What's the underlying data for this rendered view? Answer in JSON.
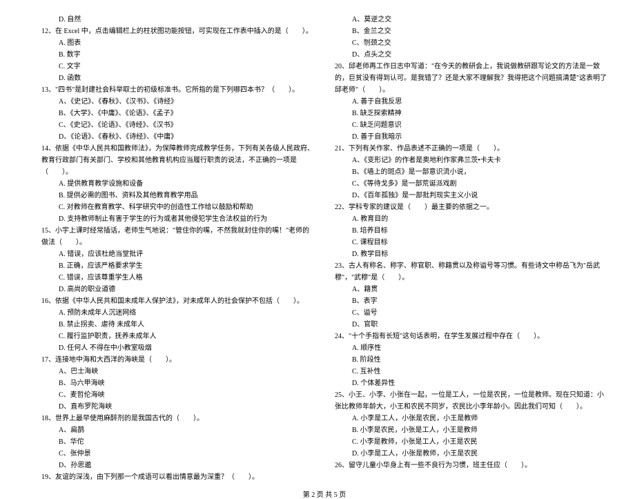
{
  "left": {
    "q11_d": "D. 自然",
    "q12": "12、在 Excel 中，点击编辑栏上的柱状图功能按钮，可实现在工作表中插入的是（　　）。",
    "q12_a": "A. 图表",
    "q12_b": "B. 数字",
    "q12_c": "C. 文字",
    "q12_d": "D. 函数",
    "q13": "13、\"四书\"是封建社会科举取士的初级标准书。它所指的是下列哪四本书？（　　）。",
    "q13_a": "A、《史记》、《春秋》、《汉书》、《诗经》",
    "q13_b": "B、《大学》、《中庸》、《论语》、《孟子》",
    "q13_c": "C、《史记》、《论语》、《诗经》、《汉书》",
    "q13_d": "D、《论语》、《春秋》、《诗经》、《中庸》",
    "q14": "14、依据《中华人民共和国教师法》，为保障教师完成教学任务，下列有关各级人民政府、教育行政部门有关部门、学校和其他教育机构应当履行职责的说法，不正确的一项是（　　）。",
    "q14_a": "A. 提供教育教学设施和设备",
    "q14_b": "B. 提供必需的图书、资料及其他教育教学用品",
    "q14_c": "C. 对教师在教育教学、科学研究中的创造性工作给以鼓励和帮助",
    "q14_d": "D. 支持教师制止有害于学生的行为或者其他侵犯学生合法权益的行为",
    "q15": "15、小宇上课时经常插话，老师生气地说：\"管住你的嘴，不然我就封住你的嘴！\"老师的做法（　　）。",
    "q15_a": "A. 错误，应该杜绝当堂批评",
    "q15_b": "B. 正确，应该严格要求学生",
    "q15_c": "C. 错误，应该尊重学生人格",
    "q15_d": "D. 高尚的职业道德",
    "q16": "16、依据《中华人民共和国未成年人保护法》，对未成年人的社会保护不包括（　　）。",
    "q16_a": "A. 预防未成年人沉迷网络",
    "q16_b": "B. 禁止拐卖、虐待 未成年人",
    "q16_c": "C. 履行监护职责，抚养未成年人",
    "q16_d": "D. 任何人 不得在中小教室吸烟",
    "q17": "17、连接地中海和大西洋的海峡是（　　）。",
    "q17_a": "A、巴士海峡",
    "q17_b": "B、马六甲海峡",
    "q17_c": "C、麦哲伦海峡",
    "q17_d": "D、直布罗陀海峡",
    "q18": "18、世界上最早使用麻醉剂的是我国古代的（　　）。",
    "q18_a": "A、扁鹊",
    "q18_b": "B、华佗",
    "q18_c": "C、张仲景",
    "q18_d": "D、孙思邈",
    "q19": "19、友谊的深浅，由下列那一个成语可以看出情意最为深重？（　　）。"
  },
  "right": {
    "q19_a": "A、莫逆之交",
    "q19_b": "B、金兰之交",
    "q19_c": "C、刎颈之交",
    "q19_d": "D、点头之交",
    "q20": "20、邱老师再工作日志中写道：\"在今天的教研会上，我说做教研跟写论文的方法是一致的，巨贫没有得到认可。是我错了？还是大家不理解我？我得把这个问题搞清楚\"这表明了邱老师\"（　　）。",
    "q20_a": "A. 善于自我反思",
    "q20_b": "B. 缺乏探索精神",
    "q20_c": "C. 缺乏问题意识",
    "q20_d": "D. 善于自我暗示",
    "q21": "21、下列有关作家、作品表述不正确的一项是（　　）。",
    "q21_a": "A、《变形记》的作者是奥地利作家弗兰茨•卡夫卡",
    "q21_b": "B、《墙上的斑点》是一部意识流小说，",
    "q21_c": "C、《等待戈多》是一部荒诞派戏剧",
    "q21_d": "D、《百年孤独》是一部批判现实主义小说",
    "q22": "22、学科专家的建议是（　　）最主要的依据之一。",
    "q22_a": "A. 教育目的",
    "q22_b": "B. 培养目标",
    "q22_c": "C. 课程目标",
    "q22_d": "D. 教学目标",
    "q23": "23、古人有称名、称字、称官职、称籍贯以及称谥号等习惯。有些诗文中称岳飞为\"岳武穆\"，\"武穆\"是（　　）。",
    "q23_a": "A、籍贯",
    "q23_b": "B、表字",
    "q23_c": "C、谥号",
    "q23_d": "D、官职",
    "q24": "24、\"十个手指有长短\"这句话表明，在学生发展过程中存在（　　）。",
    "q24_a": "A. 顺序性",
    "q24_b": "B. 阶段性",
    "q24_c": "C. 互补性",
    "q24_d": "D. 个体差异性",
    "q25": "25、小王、小李、小张在一起，一位是工人，一位是农民，一位是教师。现在只知道：小张比教师年龄大，小王和农民不同岁，农民比小李年龄小。因此我们可知（　　）。",
    "q25_a": "A. 小李是工人，小张是农民，小王是教师",
    "q25_b": "B. 小李是农民，小张是工人，小王是教师",
    "q25_c": "C. 小李是教师，小张是工人，小王是农民",
    "q25_d": "D. 小李是工人，小张是教师，小王是农民",
    "q26": "26、留守儿童小华身上有一些不良行为习惯，班主任应（　　）。"
  },
  "footer": "第 2 页 共 5 页"
}
